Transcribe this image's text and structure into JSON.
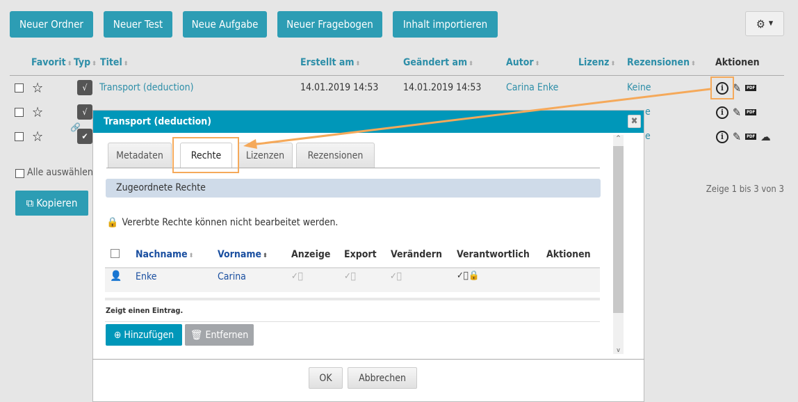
{
  "toolbar": {
    "buttons": [
      "Neuer Ordner",
      "Neuer Test",
      "Neue Aufgabe",
      "Neuer Fragebogen",
      "Inhalt importieren"
    ],
    "settings_icon": "gear-icon"
  },
  "table": {
    "headers": [
      "Favorit",
      "Typ",
      "Titel",
      "Erstellt am",
      "Geändert am",
      "Autor",
      "Lizenz",
      "Rezensionen",
      "Aktionen"
    ],
    "rows": [
      {
        "title": "Transport (deduction)",
        "created": "14.01.2019 14:53",
        "changed": "14.01.2019 14:53",
        "author": "Carina Enke",
        "reviews": "Keine"
      },
      {
        "reviews": "e"
      },
      {
        "reviews": "e"
      }
    ]
  },
  "select_all": "Alle auswählen",
  "copy_button": "Kopieren",
  "pagination": "Zeige 1 bis 3 von 3",
  "modal": {
    "title": "Transport (deduction)",
    "tabs": [
      "Metadaten",
      "Rechte",
      "Lizenzen",
      "Rezensionen"
    ],
    "active_tab": "Rechte",
    "section": "Zugeordnete Rechte",
    "notice": "Vererbte Rechte können nicht bearbeitet werden.",
    "columns": [
      "Nachname",
      "Vorname",
      "Anzeige",
      "Export",
      "Verändern",
      "Verantwortlich",
      "Aktionen"
    ],
    "rows": [
      {
        "last": "Enke",
        "first": "Carina"
      }
    ],
    "count": "Zeigt einen Eintrag.",
    "add": "Hinzufügen",
    "remove": "Entfernen",
    "ok": "OK",
    "cancel": "Abbrechen"
  },
  "colors": {
    "accent": "#2d9db4",
    "modal_header": "#0097b9",
    "highlight": "#f5a95a"
  }
}
